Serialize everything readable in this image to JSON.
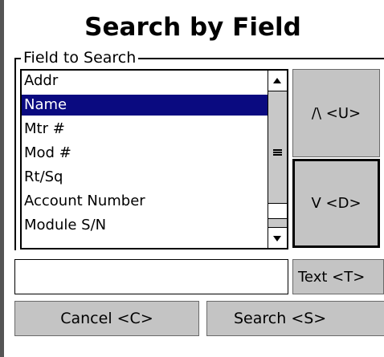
{
  "title": "Search by Field",
  "field_group": {
    "legend": "Field to Search",
    "items": [
      {
        "label": "Addr",
        "selected": false
      },
      {
        "label": "Name",
        "selected": true
      },
      {
        "label": "Mtr #",
        "selected": false
      },
      {
        "label": "Mod #",
        "selected": false
      },
      {
        "label": "Rt/Sq",
        "selected": false
      },
      {
        "label": "Account Number",
        "selected": false
      },
      {
        "label": "Module S/N",
        "selected": false
      }
    ]
  },
  "buttons": {
    "up_label": "/\\ <U>",
    "down_label": "V <D>",
    "text_label": "Text <T>",
    "cancel_label": "Cancel <C>",
    "search_label": "Search <S>"
  },
  "search_input": {
    "value": "",
    "placeholder": ""
  },
  "colors": {
    "selection_bg": "#0a0a80",
    "selection_fg": "#ffffff",
    "button_bg": "#c4c4c4"
  },
  "icons": {
    "scroll_up": "scroll-up-arrow-icon",
    "scroll_down": "scroll-down-arrow-icon",
    "scroll_grip": "scrollbar-grip-icon"
  }
}
